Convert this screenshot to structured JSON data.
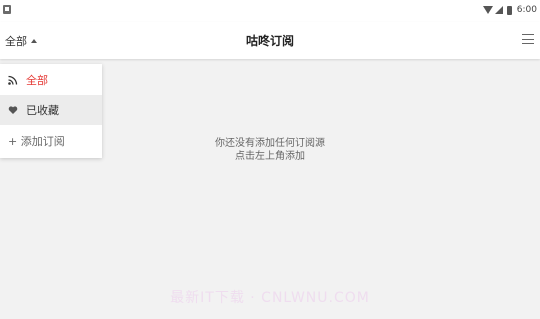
{
  "status_bar": {
    "time": "6:00",
    "icons": [
      "notification-icon",
      "wifi-icon",
      "signal-icon",
      "battery-icon"
    ]
  },
  "app_bar": {
    "filter_label": "全部",
    "title": "咕咚订阅",
    "menu_icon": "hamburger-menu-icon"
  },
  "dropdown": {
    "items": [
      {
        "label": "全部",
        "icon": "rss-icon",
        "selected": true
      },
      {
        "label": "已收藏",
        "icon": "heart-icon",
        "selected": false
      },
      {
        "label": "+ 添加订阅",
        "icon": null,
        "selected": false
      }
    ]
  },
  "empty_state": {
    "line1": "你还没有添加任何订阅源",
    "line2": "点击左上角添加"
  },
  "watermark": "最新IT下载 · CNLWNU.COM",
  "colors": {
    "accent": "#e53935",
    "background": "#f2f2f2",
    "surface": "#ffffff"
  }
}
